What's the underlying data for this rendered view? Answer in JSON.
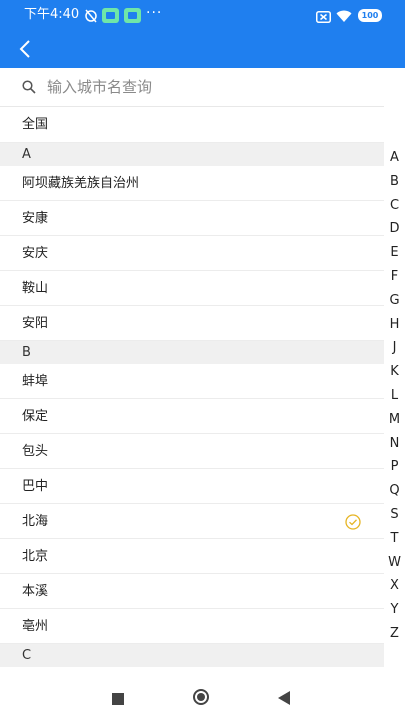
{
  "status_bar": {
    "time": "下午4:40",
    "more": "···",
    "battery": "100"
  },
  "search": {
    "placeholder": "输入城市名查询"
  },
  "all_label": "全国",
  "sections": [
    {
      "letter": "A",
      "cities": [
        "阿坝藏族羌族自治州",
        "安康",
        "安庆",
        "鞍山",
        "安阳"
      ]
    },
    {
      "letter": "B",
      "cities": [
        "蚌埠",
        "保定",
        "包头",
        "巴中",
        "北海",
        "北京",
        "本溪",
        "亳州"
      ]
    },
    {
      "letter": "C",
      "cities": []
    }
  ],
  "selected_city": "北海",
  "index_letters": [
    "A",
    "B",
    "C",
    "D",
    "E",
    "F",
    "G",
    "H",
    "J",
    "K",
    "L",
    "M",
    "N",
    "P",
    "Q",
    "S",
    "T",
    "W",
    "X",
    "Y",
    "Z"
  ],
  "colors": {
    "primary": "#1f7fef",
    "check": "#e6b422",
    "section_bg": "#f0f0f0"
  }
}
